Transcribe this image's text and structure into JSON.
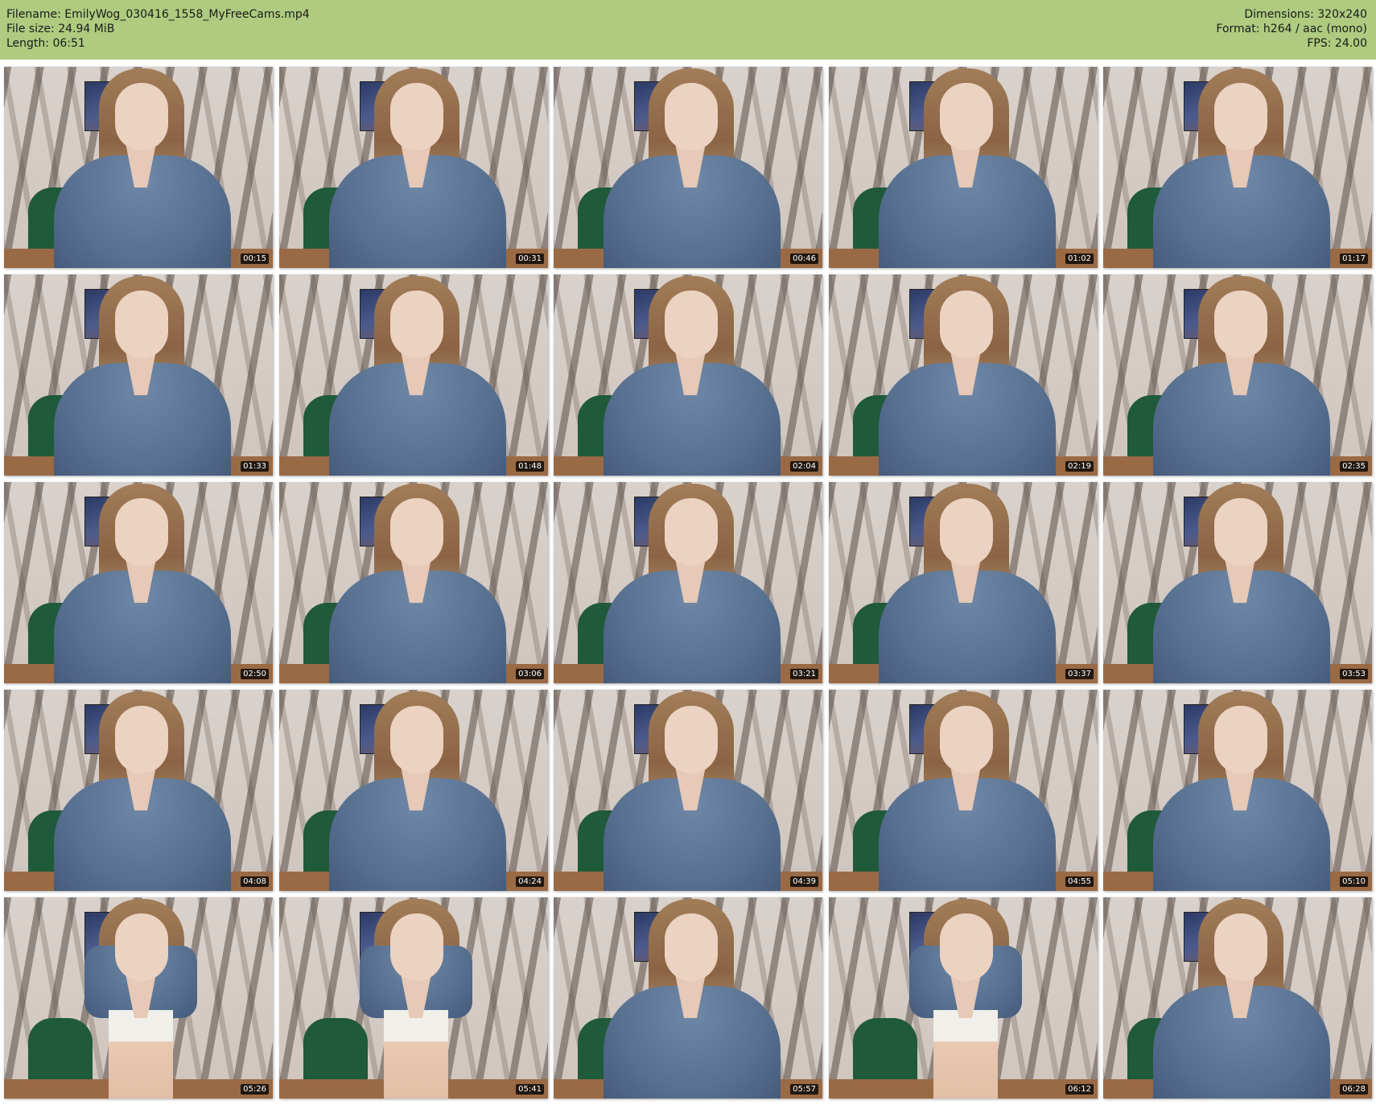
{
  "header": {
    "filename": "Filename: EmilyWog_030416_1558_MyFreeCams.mp4",
    "filesize": "File size: 24.94 MiB",
    "length": "Length: 06:51",
    "dimensions": "Dimensions: 320x240",
    "format": "Format: h264 / aac (mono)",
    "fps": "FPS: 24.00"
  },
  "colors": {
    "header_bg": "#aecb7f"
  },
  "thumbnails": [
    {
      "timestamp": "00:15"
    },
    {
      "timestamp": "00:31"
    },
    {
      "timestamp": "00:46"
    },
    {
      "timestamp": "01:02"
    },
    {
      "timestamp": "01:17"
    },
    {
      "timestamp": "01:33"
    },
    {
      "timestamp": "01:48"
    },
    {
      "timestamp": "02:04"
    },
    {
      "timestamp": "02:19"
    },
    {
      "timestamp": "02:35"
    },
    {
      "timestamp": "02:50"
    },
    {
      "timestamp": "03:06"
    },
    {
      "timestamp": "03:21"
    },
    {
      "timestamp": "03:37"
    },
    {
      "timestamp": "03:53"
    },
    {
      "timestamp": "04:08"
    },
    {
      "timestamp": "04:24"
    },
    {
      "timestamp": "04:39"
    },
    {
      "timestamp": "04:55"
    },
    {
      "timestamp": "05:10"
    },
    {
      "timestamp": "05:26"
    },
    {
      "timestamp": "05:41"
    },
    {
      "timestamp": "05:57"
    },
    {
      "timestamp": "06:12"
    },
    {
      "timestamp": "06:28"
    }
  ]
}
